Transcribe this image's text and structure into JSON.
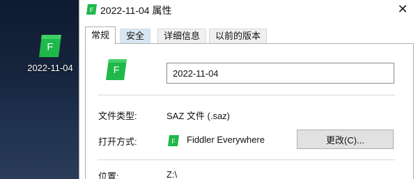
{
  "desktop": {
    "icon": {
      "name": "fiddler-file-icon",
      "letter": "F",
      "label": "2022-11-04"
    }
  },
  "dialog": {
    "title": "2022-11-04 属性",
    "close_glyph": "✕",
    "tabs": [
      {
        "label": "常规",
        "active": true
      },
      {
        "label": "安全",
        "active": false
      },
      {
        "label": "详细信息",
        "active": false
      },
      {
        "label": "以前的版本",
        "active": false
      }
    ],
    "general": {
      "file_name": "2022-11-04",
      "file_type_label": "文件类型:",
      "file_type_value": "SAZ 文件 (.saz)",
      "opens_with_label": "打开方式:",
      "opens_with_app": "Fiddler Everywhere",
      "change_button": "更改(C)...",
      "location_label": "位置:",
      "location_value": "Z:\\"
    }
  },
  "colors": {
    "icon_green": "#1fb84a",
    "icon_dark": "#0f7a2e",
    "tab_hover": "#d8e6f2"
  }
}
